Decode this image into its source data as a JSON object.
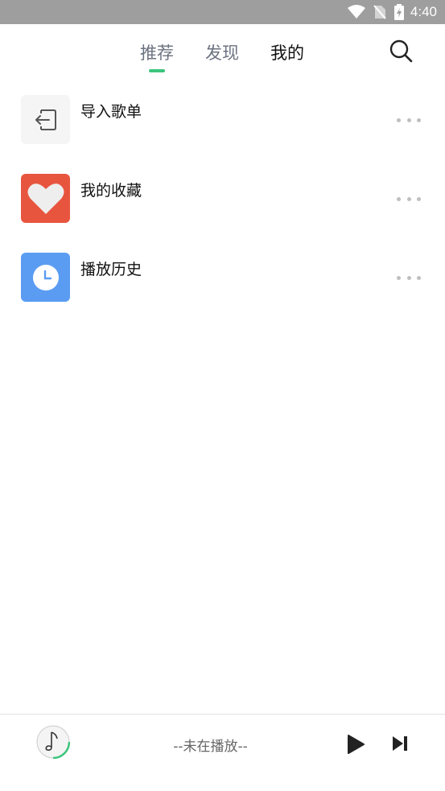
{
  "status_bar": {
    "time": "4:40"
  },
  "nav": {
    "tabs": [
      {
        "label": "推荐",
        "active": true
      },
      {
        "label": "发现",
        "active": false
      },
      {
        "label": "我的",
        "active": false
      }
    ]
  },
  "list": {
    "items": [
      {
        "label": "导入歌单",
        "icon": "import-icon",
        "color": "#f5f5f5"
      },
      {
        "label": "我的收藏",
        "icon": "heart-icon",
        "color": "#e8553f"
      },
      {
        "label": "播放历史",
        "icon": "clock-icon",
        "color": "#5b9cf3"
      }
    ]
  },
  "player": {
    "status_text": "--未在播放--"
  },
  "colors": {
    "accent": "#3cc47c",
    "status_bar": "#9e9e9e"
  }
}
